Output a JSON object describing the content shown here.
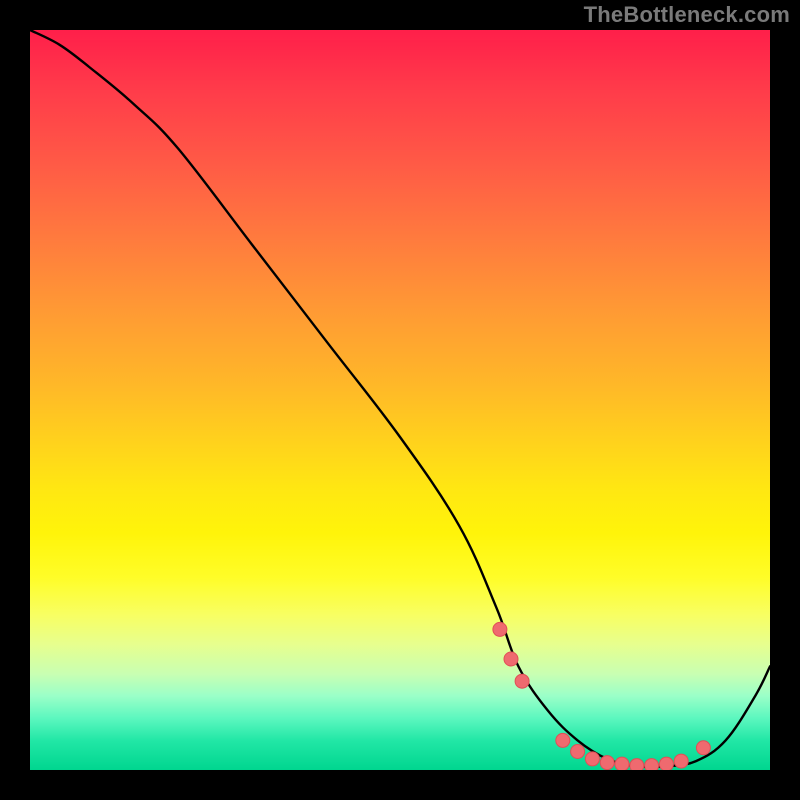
{
  "watermark": "TheBottleneck.com",
  "chart_data": {
    "type": "line",
    "title": "",
    "xlabel": "",
    "ylabel": "",
    "xlim": [
      0,
      100
    ],
    "ylim": [
      0,
      100
    ],
    "grid": false,
    "series": [
      {
        "name": "curve",
        "x": [
          0,
          4,
          8,
          14,
          20,
          30,
          40,
          50,
          58,
          63,
          66,
          70,
          74,
          78,
          82,
          86,
          90,
          94,
          98,
          100
        ],
        "y": [
          100,
          98,
          95,
          90,
          84,
          71,
          58,
          45,
          33,
          22,
          14,
          8,
          4,
          1.5,
          0.5,
          0.5,
          1.2,
          4,
          10,
          14
        ]
      }
    ],
    "markers": {
      "name": "highlight-dots",
      "x": [
        63.5,
        65,
        66.5,
        72,
        74,
        76,
        78,
        80,
        82,
        84,
        86,
        88,
        91
      ],
      "y": [
        19,
        15,
        12,
        4,
        2.5,
        1.5,
        1,
        0.8,
        0.6,
        0.6,
        0.8,
        1.2,
        3
      ]
    }
  }
}
